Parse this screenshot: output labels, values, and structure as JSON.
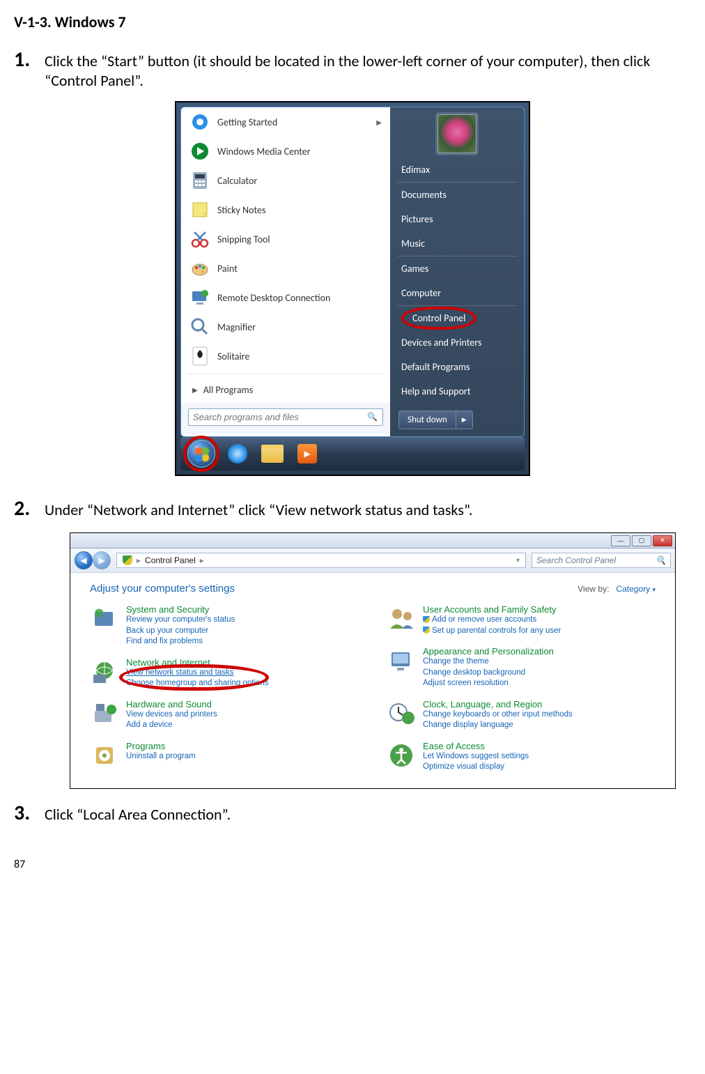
{
  "heading": "V-1-3.    Windows 7",
  "steps": {
    "s1_num": "1.",
    "s1_text": "Click the “Start” button (it should be located in the lower-left corner of your computer), then click “Control Panel”.",
    "s2_num": "2.",
    "s2_text": "Under “Network and Internet” click “View network status and tasks”.",
    "s3_num": "3.",
    "s3_text": "Click “Local Area Connection”."
  },
  "start_menu": {
    "left_items": [
      {
        "label": "Getting Started",
        "has_sub": true
      },
      {
        "label": "Windows Media Center"
      },
      {
        "label": "Calculator"
      },
      {
        "label": "Sticky Notes"
      },
      {
        "label": "Snipping Tool"
      },
      {
        "label": "Paint"
      },
      {
        "label": "Remote Desktop Connection"
      },
      {
        "label": "Magnifier"
      },
      {
        "label": "Solitaire"
      }
    ],
    "all_programs": "All Programs",
    "search_placeholder": "Search programs and files",
    "right_items": [
      "Edimax",
      "Documents",
      "Pictures",
      "Music",
      "Games",
      "Computer",
      "Control Panel",
      "Devices and Printers",
      "Default Programs",
      "Help and Support"
    ],
    "shut_down": "Shut down"
  },
  "control_panel": {
    "breadcrumb": "Control Panel",
    "search_placeholder": "Search Control Panel",
    "heading": "Adjust your computer's settings",
    "viewby_label": "View by:",
    "viewby_value": "Category",
    "left": [
      {
        "title": "System and Security",
        "links": [
          "Review your computer's status",
          "Back up your computer",
          "Find and fix problems"
        ]
      },
      {
        "title": "Network and Internet",
        "links": [
          "View network status and tasks",
          "Choose homegroup and sharing options"
        ],
        "circle": true
      },
      {
        "title": "Hardware and Sound",
        "links": [
          "View devices and printers",
          "Add a device"
        ]
      },
      {
        "title": "Programs",
        "links": [
          "Uninstall a program"
        ]
      }
    ],
    "right": [
      {
        "title": "User Accounts and Family Safety",
        "links": [
          "Add or remove user accounts",
          "Set up parental controls for any user"
        ],
        "shield": true
      },
      {
        "title": "Appearance and Personalization",
        "links": [
          "Change the theme",
          "Change desktop background",
          "Adjust screen resolution"
        ]
      },
      {
        "title": "Clock, Language, and Region",
        "links": [
          "Change keyboards or other input methods",
          "Change display language"
        ]
      },
      {
        "title": "Ease of Access",
        "links": [
          "Let Windows suggest settings",
          "Optimize visual display"
        ]
      }
    ]
  },
  "page_number": "87"
}
